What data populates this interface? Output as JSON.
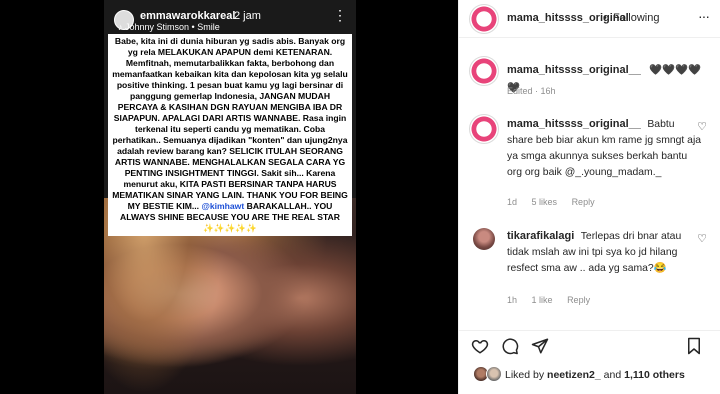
{
  "story": {
    "username": "emmawarokkareal",
    "time": "2 jam",
    "music": "Johnny Stimson • Smile",
    "more": "⋮",
    "text": "Babe, kita ini di dunia hiburan yg sadis abis. Banyak org yg rela MELAKUKAN APAPUN demi KETENARAN. Memfitnah, memutarbalikkan fakta, berbohong dan memanfaatkan kebaikan kita dan kepolosan kita yg selalu positive thinking. 1 pesan buat kamu yg lagi bersinar di panggung gemerlap Indonesia, JANGAN MUDAH PERCAYA & KASIHAN DGN RAYUAN MENGIBA IBA DR SIAPAPUN. APALAGI DARI ARTIS WANNABE. Rasa ingin terkenal itu seperti candu yg mematikan. Coba perhatikan.. Semuanya dijadikan \"konten\" dan ujung2nya adalah review barang kan? SELICIK ITULAH SEORANG ARTIS WANNABE. MENGHALALKAN SEGALA CARA YG PENTING INSIGHTMENT TINGGI. Sakit sih... Karena menurut aku, KITA PASTI BERSINAR TANPA HARUS MEMATIKAN SINAR YANG LAIN. THANK YOU FOR BEING MY BESTIE KIM...",
    "tag": "@kimhawt",
    "text_end": " BARAKALLAH.. YOU ALWAYS SHINE BECAUSE YOU ARE THE REAL STAR ✨✨✨✨✨"
  },
  "header": {
    "username": "mama_hitssss_original",
    "separator": "•",
    "follow_label": "Following",
    "more": "···"
  },
  "comments": [
    {
      "username": "mama_hitssss_original__",
      "text": "🖤🖤🖤🖤🖤",
      "meta": [
        "Edited · 16h"
      ]
    },
    {
      "username": "mama_hitssss_original__",
      "text": "Babtu share beb biar akun km rame jg smngt aja ya smga akunnya sukses berkah bantu org org baik @_.young_madam._",
      "meta": [
        "1d",
        "5 likes",
        "Reply"
      ]
    },
    {
      "username": "tikarafikalagi",
      "text": "Terlepas dri bnar atau tidak mslah aw ini tpi sya ko jd hilang resfect sma aw .. ada yg sama?😂",
      "meta": [
        "1h",
        "1 like",
        "Reply"
      ]
    }
  ],
  "likes": {
    "prefix": "Liked by",
    "user": "neetizen2_",
    "mid": "and",
    "count": "1,110 others"
  },
  "icons": {
    "heart": "heart-icon",
    "comment": "comment-icon",
    "share": "share-icon",
    "bookmark": "bookmark-icon"
  }
}
